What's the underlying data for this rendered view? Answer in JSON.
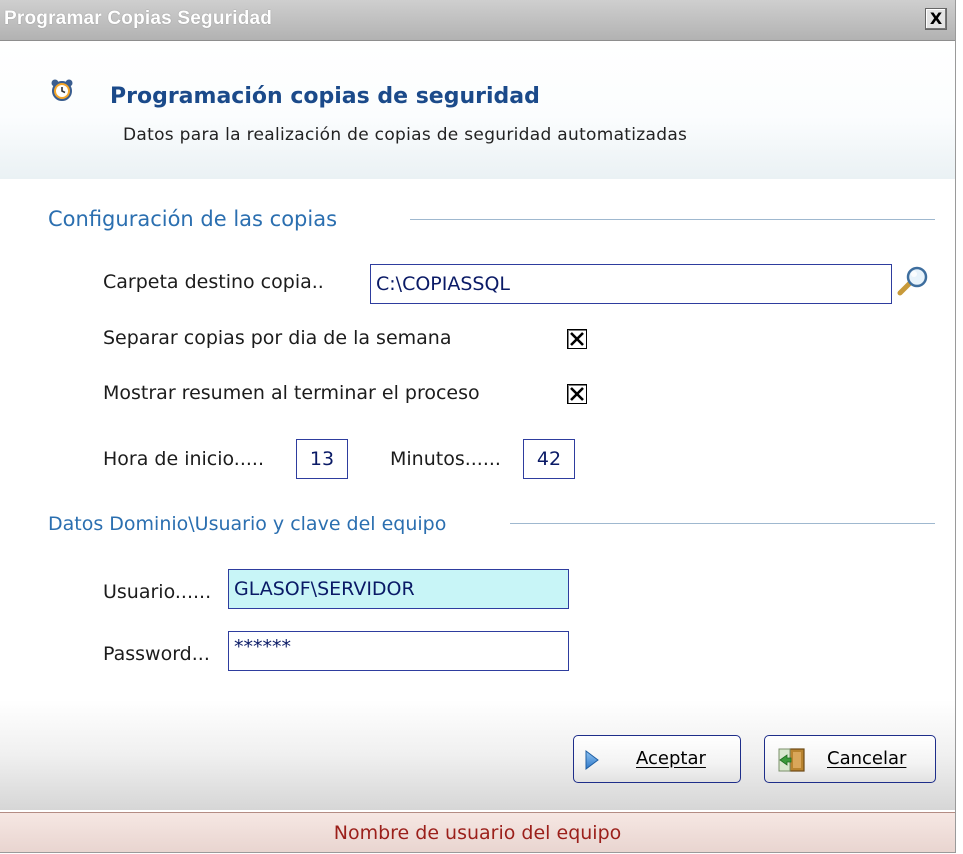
{
  "window": {
    "title": "Programar Copias Seguridad",
    "close_label": "X"
  },
  "header": {
    "icon": "alarm-clock-icon",
    "title": "Programación copias de seguridad",
    "subtitle": "Datos para la realización de copias de seguridad automatizadas"
  },
  "config_section": {
    "title": "Configuración de las copias",
    "dest_label": "Carpeta destino copia..",
    "dest_value": "C:\\COPIASSQL",
    "separate_label": "Separar copias por dia de la semana",
    "separate_checked": true,
    "summary_label": "Mostrar resumen al terminar el proceso",
    "summary_checked": true,
    "hour_label": "Hora de inicio.....",
    "hour_value": "13",
    "minutes_label": "Minutos......",
    "minutes_value": "42"
  },
  "domain_section": {
    "title": "Datos Dominio\\Usuario y clave del equipo",
    "user_label": "Usuario......",
    "user_value": "GLASOF\\SERVIDOR",
    "password_label": "Password...",
    "password_value": "******"
  },
  "buttons": {
    "accept_label": "Aceptar",
    "cancel_label": "Cancelar"
  },
  "status": {
    "text": "Nombre de usuario del equipo"
  },
  "colors": {
    "accent": "#2b6fb0",
    "status_text": "#9b1f1a",
    "highlight_field": "#c8f5f7"
  }
}
